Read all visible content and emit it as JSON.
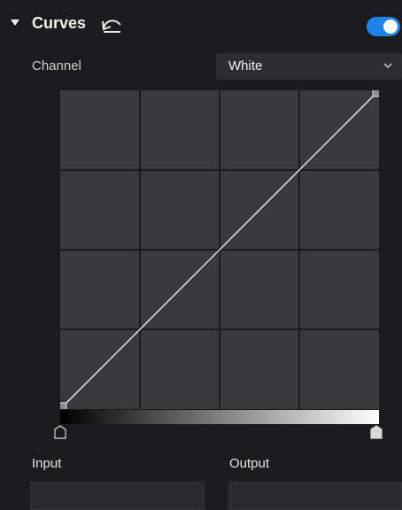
{
  "header": {
    "title": "Curves",
    "undo_icon": "undo-icon",
    "toggle_enabled": true,
    "accent": "#1e82ea"
  },
  "channel": {
    "label": "Channel",
    "selected": "White"
  },
  "curve": {
    "grid_divisions": 4,
    "points": [
      {
        "input": 0,
        "output": 0
      },
      {
        "input": 255,
        "output": 255
      }
    ],
    "background": "#3a393e",
    "grid_color": "#1b1b1d",
    "line_color": "#ffffff"
  },
  "io": {
    "input_label": "Input",
    "output_label": "Output",
    "input_value": "",
    "output_value": ""
  }
}
